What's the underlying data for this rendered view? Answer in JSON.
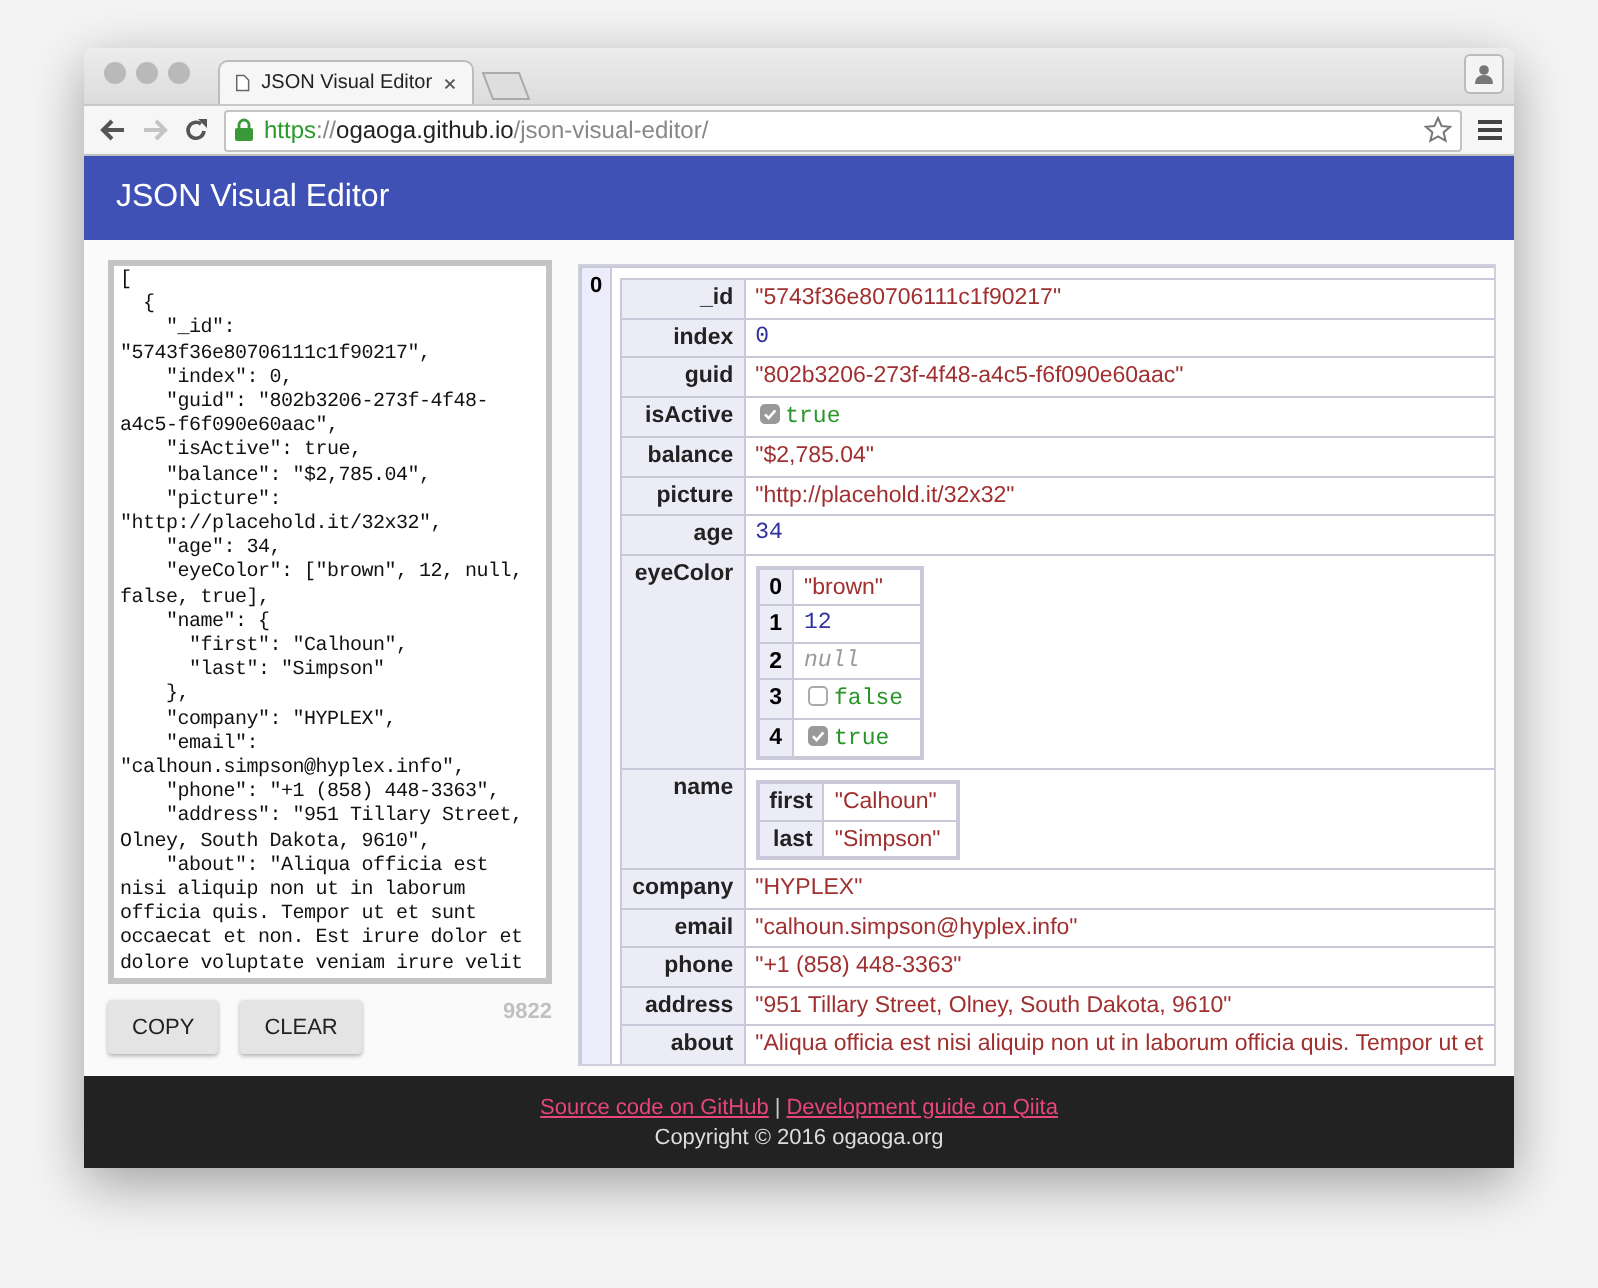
{
  "browser": {
    "tab_title": "JSON Visual Editor",
    "url_parts": [
      {
        "kind": "scheme",
        "text": "https"
      },
      {
        "kind": "separator",
        "text": "://"
      },
      {
        "kind": "host",
        "text": "ogaoga.github.io"
      },
      {
        "kind": "path",
        "text": "/json-visual-editor/"
      }
    ],
    "forward_disabled": true
  },
  "header": {
    "title": "JSON Visual Editor"
  },
  "editor": {
    "value": "[\n  {\n    \"_id\":\n\"5743f36e80706111c1f90217\",\n    \"index\": 0,\n    \"guid\": \"802b3206-273f-4f48-\na4c5-f6f090e60aac\",\n    \"isActive\": true,\n    \"balance\": \"$2,785.04\",\n    \"picture\":\n\"http://placehold.it/32x32\",\n    \"age\": 34,\n    \"eyeColor\": [\"brown\", 12, null,\nfalse, true],\n    \"name\": {\n      \"first\": \"Calhoun\",\n      \"last\": \"Simpson\"\n    },\n    \"company\": \"HYPLEX\",\n    \"email\":\n\"calhoun.simpson@hyplex.info\",\n    \"phone\": \"+1 (858) 448-3363\",\n    \"address\": \"951 Tillary Street,\nOlney, South Dakota, 9610\",\n    \"about\": \"Aliqua officia est\nnisi aliquip non ut in laborum\nofficia quis. Tempor ut et sunt\noccaecat et non. Est irure dolor et\ndolore voluptate veniam irure velit",
    "buttons": [
      {
        "label": "COPY"
      },
      {
        "label": "CLEAR"
      }
    ],
    "count": "9822"
  },
  "records": [
    {
      "index": "0",
      "fields": [
        {
          "key": "_id",
          "value": {
            "kind": "string",
            "text": "\"5743f36e80706111c1f90217\""
          }
        },
        {
          "key": "index",
          "value": {
            "kind": "number",
            "text": "0"
          }
        },
        {
          "key": "guid",
          "value": {
            "kind": "string",
            "text": "\"802b3206-273f-4f48-a4c5-f6f090e60aac\""
          }
        },
        {
          "key": "isActive",
          "value": {
            "kind": "boolean",
            "text": "true",
            "checked": true
          }
        },
        {
          "key": "balance",
          "value": {
            "kind": "string",
            "text": "\"$2,785.04\""
          }
        },
        {
          "key": "picture",
          "value": {
            "kind": "string",
            "text": "\"http://placehold.it/32x32\""
          }
        },
        {
          "key": "age",
          "value": {
            "kind": "number",
            "text": "34"
          }
        },
        {
          "key": "eyeColor",
          "value": {
            "kind": "array",
            "items": [
              {
                "index": "0",
                "value": {
                  "kind": "string",
                  "text": "\"brown\""
                }
              },
              {
                "index": "1",
                "value": {
                  "kind": "number",
                  "text": "12"
                }
              },
              {
                "index": "2",
                "value": {
                  "kind": "null",
                  "text": "null"
                }
              },
              {
                "index": "3",
                "value": {
                  "kind": "boolean",
                  "text": "false",
                  "checked": false
                }
              },
              {
                "index": "4",
                "value": {
                  "kind": "boolean",
                  "text": "true",
                  "checked": true
                }
              }
            ]
          }
        },
        {
          "key": "name",
          "value": {
            "kind": "object",
            "fields": [
              {
                "key": "first",
                "value": {
                  "kind": "string",
                  "text": "\"Calhoun\""
                }
              },
              {
                "key": "last",
                "value": {
                  "kind": "string",
                  "text": "\"Simpson\""
                }
              }
            ]
          }
        },
        {
          "key": "company",
          "value": {
            "kind": "string",
            "text": "\"HYPLEX\""
          }
        },
        {
          "key": "email",
          "value": {
            "kind": "string",
            "text": "\"calhoun.simpson@hyplex.info\""
          }
        },
        {
          "key": "phone",
          "value": {
            "kind": "string",
            "text": "\"+1 (858) 448-3363\""
          }
        },
        {
          "key": "address",
          "value": {
            "kind": "string",
            "text": "\"951 Tillary Street, Olney, South Dakota, 9610\""
          }
        },
        {
          "key": "about",
          "value": {
            "kind": "string",
            "text": "\"Aliqua officia est nisi aliquip non ut in laborum officia quis. Tempor ut et"
          }
        }
      ]
    }
  ],
  "footer": {
    "links": [
      {
        "text": "Source code on GitHub"
      },
      {
        "text": "Development guide on Qiita"
      }
    ],
    "separator": "|",
    "copyright": "Copyright © 2016 ogaoga.org"
  }
}
